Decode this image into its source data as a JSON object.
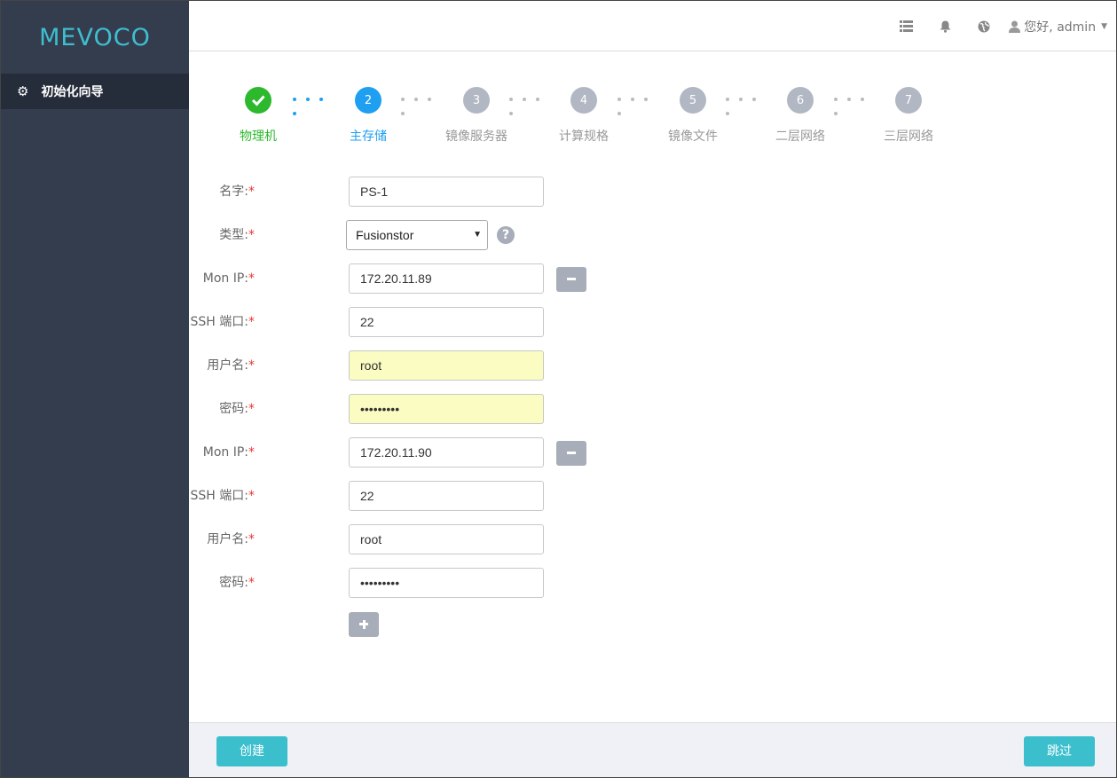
{
  "app": {
    "logo": "MEVOCO"
  },
  "sidebar": {
    "items": [
      {
        "label": "初始化向导",
        "icon": "gear-icon"
      }
    ]
  },
  "topbar": {
    "user_greeting": "您好, admin"
  },
  "wizard": {
    "steps": [
      {
        "num": "✔",
        "label": "物理机",
        "state": "done"
      },
      {
        "num": "2",
        "label": "主存储",
        "state": "active"
      },
      {
        "num": "3",
        "label": "镜像服务器",
        "state": "todo"
      },
      {
        "num": "4",
        "label": "计算规格",
        "state": "todo"
      },
      {
        "num": "5",
        "label": "镜像文件",
        "state": "todo"
      },
      {
        "num": "6",
        "label": "二层网络",
        "state": "todo"
      },
      {
        "num": "7",
        "label": "三层网络",
        "state": "todo"
      }
    ]
  },
  "form": {
    "name": {
      "label": "名字:",
      "value": "PS-1"
    },
    "type": {
      "label": "类型:",
      "value": "Fusionstor"
    },
    "required_mark": "*",
    "mons": [
      {
        "ip_label": "Mon IP:",
        "ip": "172.20.11.89",
        "ssh_label": "SSH 端口:",
        "ssh": "22",
        "user_label": "用户名:",
        "user": "root",
        "pass_label": "密码:",
        "pass": "•••••••••"
      },
      {
        "ip_label": "Mon IP:",
        "ip": "172.20.11.90",
        "ssh_label": "SSH 端口:",
        "ssh": "22",
        "user_label": "用户名:",
        "user": "root",
        "pass_label": "密码:",
        "pass": "•••••••••"
      }
    ]
  },
  "footer": {
    "create_label": "创建",
    "skip_label": "跳过"
  },
  "colors": {
    "accent": "#3bbfcd",
    "sidebar": "#333d4e",
    "done": "#2db82d",
    "active": "#1e9ff2"
  }
}
